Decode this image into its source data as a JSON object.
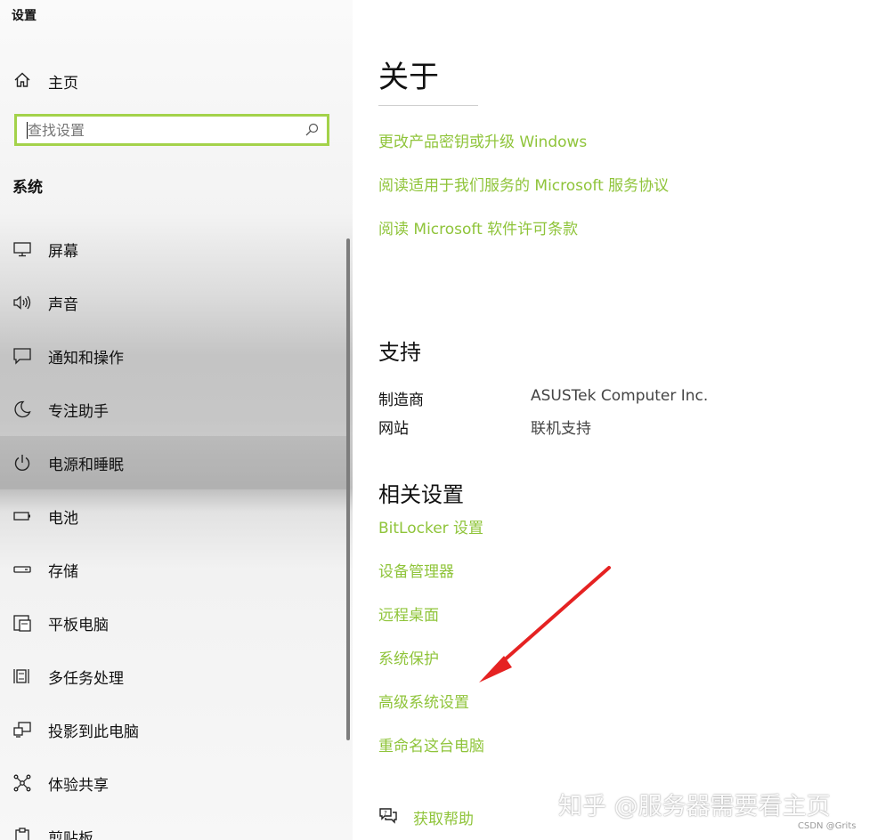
{
  "window": {
    "title": "设置"
  },
  "sidebar": {
    "home_label": "主页",
    "search": {
      "placeholder": "查找设置",
      "value": ""
    },
    "section_heading": "系统",
    "items": [
      {
        "label": "屏幕",
        "icon": "monitor-icon",
        "selected": false
      },
      {
        "label": "声音",
        "icon": "speaker-icon",
        "selected": false
      },
      {
        "label": "通知和操作",
        "icon": "notification-icon",
        "selected": false
      },
      {
        "label": "专注助手",
        "icon": "moon-icon",
        "selected": false
      },
      {
        "label": "电源和睡眠",
        "icon": "power-icon",
        "selected": true
      },
      {
        "label": "电池",
        "icon": "battery-icon",
        "selected": false
      },
      {
        "label": "存储",
        "icon": "storage-icon",
        "selected": false
      },
      {
        "label": "平板电脑",
        "icon": "tablet-icon",
        "selected": false
      },
      {
        "label": "多任务处理",
        "icon": "multitask-icon",
        "selected": false
      },
      {
        "label": "投影到此电脑",
        "icon": "project-icon",
        "selected": false
      },
      {
        "label": "体验共享",
        "icon": "share-icon",
        "selected": false
      },
      {
        "label": "剪贴板",
        "icon": "clipboard-icon",
        "selected": false
      }
    ]
  },
  "main": {
    "title": "关于",
    "top_links": [
      "更改产品密钥或升级 Windows",
      "阅读适用于我们服务的 Microsoft 服务协议",
      "阅读 Microsoft 软件许可条款"
    ],
    "support": {
      "heading": "支持",
      "manufacturer_key": "制造商",
      "manufacturer_value": "ASUSTek Computer Inc.",
      "website_key": "网站",
      "website_value": "联机支持"
    },
    "related": {
      "heading": "相关设置",
      "links": [
        "BitLocker 设置",
        "设备管理器",
        "远程桌面",
        "系统保护",
        "高级系统设置",
        "重命名这台电脑"
      ]
    },
    "help_label": "获取帮助"
  },
  "overlay": {
    "watermark": "知乎 @服务器需要看主页",
    "credit": "CSDN @Grits",
    "arrow_color": "#e52222"
  },
  "colors": {
    "accent": "#8fc43a",
    "search_border": "#a3d24a"
  }
}
